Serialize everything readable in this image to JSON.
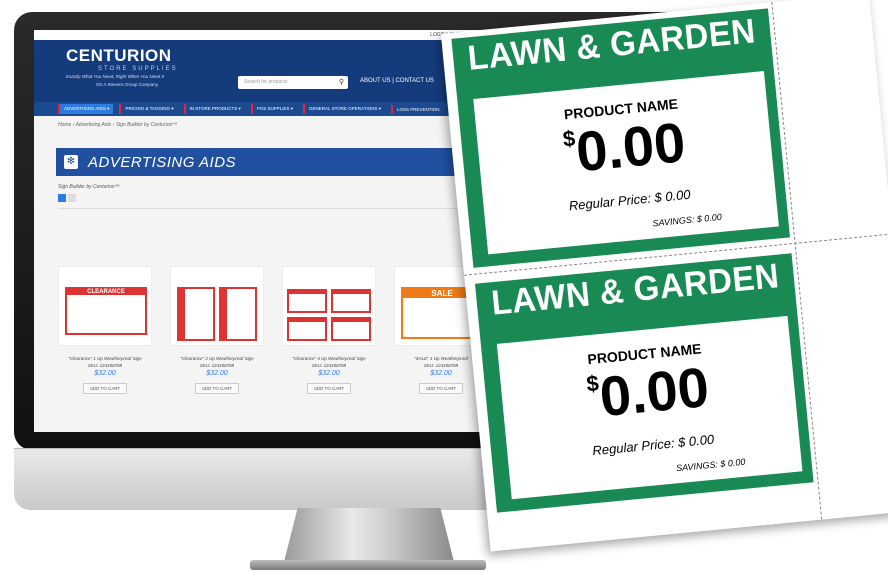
{
  "website": {
    "top_links": "LOGIN | SHOP",
    "logo": {
      "name": "CENTURION",
      "sub": "STORE SUPPLIES",
      "tagline": "Exactly What You Need, Right When You Need It",
      "group": "SG A Stevens Group Company"
    },
    "search_placeholder": "Search for products",
    "header_links": "ABOUT US  |  CONTACT US",
    "nav": [
      "ADVERTISING AIDS ▾",
      "PRICING & TAGGING ▾",
      "IN STORE PRODUCTS ▾",
      "POS SUPPLIES ▾",
      "GENERAL STORE OPERATIONS ▾",
      "LOSS PREVENTION",
      "RE"
    ],
    "breadcrumb": "Home  ›  Advertising Aids  ›  Sign Builder by Centurion™",
    "banner_title": "ADVERTISING AIDS",
    "subtitle": "Sign Builder by Centurion™",
    "products": [
      {
        "name": "\"Clearance\" 1 Up Weatherproof Sign",
        "sku": "SKU: 123456789",
        "price": "$32.00",
        "cart": "ADD TO CART",
        "tag": "CLEARANCE"
      },
      {
        "name": "\"Clearance\" 2 Up Weatherproof Sign",
        "sku": "SKU: 123456789",
        "price": "$32.00",
        "cart": "ADD TO CART",
        "tag": "CLEARANCE"
      },
      {
        "name": "\"Clearance\" 4 Up Weatherproof Sign",
        "sku": "SKU: 123456789",
        "price": "$32.00",
        "cart": "ADD TO CART",
        "tag": "CLEARANCE"
      },
      {
        "name": "\"SALE\" 1 Up Weatherproof",
        "sku": "SKU: 123456789",
        "price": "$32.00",
        "cart": "ADD TO CART",
        "tag": "SALE"
      }
    ]
  },
  "sign_sheet": {
    "signs": [
      {
        "title": "LAWN & GARDEN",
        "product_name": "PRODUCT NAME",
        "currency": "$",
        "price": "0.00",
        "regular_price": "Regular Price: $ 0.00",
        "savings": "SAVINGS: $ 0.00"
      },
      {
        "title": "LAWN & GARDEN",
        "product_name": "PRODUCT NAME",
        "currency": "$",
        "price": "0.00",
        "regular_price": "Regular Price: $ 0.00",
        "savings": "SAVINGS: $ 0.00"
      }
    ],
    "colors": {
      "sign_green": "#1a8a54"
    }
  },
  "colors": {
    "header_blue": "#143c7c",
    "banner_blue": "#2150a0",
    "price_blue": "#2b7be0",
    "clearance_red": "#d33",
    "sale_orange": "#f07a18"
  }
}
